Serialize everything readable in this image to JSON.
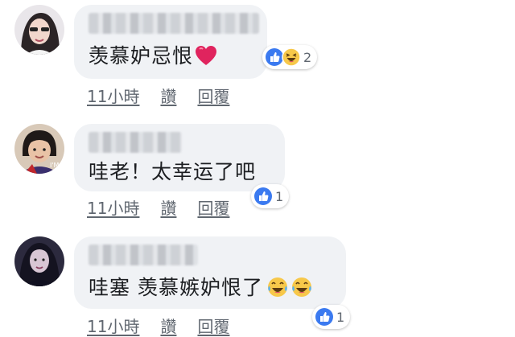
{
  "comments": [
    {
      "text": "羡慕妒忌恨",
      "emoji": "red-heart-icon",
      "reactions": {
        "icons": [
          "like-icon",
          "haha-icon"
        ],
        "count": "2"
      },
      "actions": {
        "time": "11小時",
        "like": "讚",
        "reply": "回覆"
      }
    },
    {
      "text": "哇老！太幸运了吧",
      "reactions": {
        "icons": [
          "like-icon"
        ],
        "count": "1"
      },
      "actions": {
        "time": "11小時",
        "like": "讚",
        "reply": "回覆"
      }
    },
    {
      "text": "哇塞 羡慕嫉妒恨了",
      "emoji": "laughing-tears-icon x2",
      "reactions": {
        "icons": [
          "like-icon"
        ],
        "count": "1"
      },
      "actions": {
        "time": "11小時",
        "like": "讚",
        "reply": "回覆"
      }
    }
  ],
  "colors": {
    "bubble_bg": "#f0f2f5",
    "text": "#1c1e21",
    "meta": "#606770",
    "like_blue": "#3b7af0",
    "haha_yellow": "#f7c84a",
    "heart_red": "#e0245e"
  }
}
